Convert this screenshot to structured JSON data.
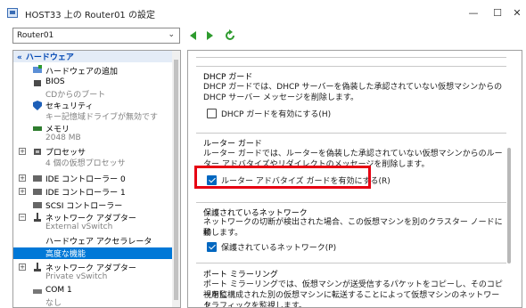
{
  "window": {
    "title": "HOST33 上の Router01 の設定",
    "minimize_glyph": "—",
    "maximize_glyph": "☐",
    "close_glyph": "✕"
  },
  "toolbar": {
    "vm_selected": "Router01"
  },
  "tree": {
    "section_label": "ハードウェア",
    "items": [
      {
        "label": "ハードウェアの追加",
        "sub": ""
      },
      {
        "label": "BIOS",
        "sub": "CDからのブート"
      },
      {
        "label": "セキュリティ",
        "sub": "キー記憶域ドライブが無効です"
      },
      {
        "label": "メモリ",
        "sub": "2048 MB"
      },
      {
        "label": "プロセッサ",
        "sub": "4 個の仮想プロセッサ"
      },
      {
        "label": "IDE コントローラー 0",
        "sub": ""
      },
      {
        "label": "IDE コントローラー 1",
        "sub": ""
      },
      {
        "label": "SCSI コントローラー",
        "sub": ""
      },
      {
        "label": "ネットワーク アダプター",
        "sub": "External vSwitch"
      },
      {
        "label": "ハードウェア アクセラレータ",
        "sub": ""
      },
      {
        "label": "高度な機能",
        "sub": ""
      },
      {
        "label": "ネットワーク アダプター",
        "sub": "Private vSwitch"
      },
      {
        "label": "COM 1",
        "sub": "なし"
      }
    ]
  },
  "panel": {
    "dhcp_guard": {
      "title": "DHCP ガード",
      "desc_line1": "DHCP ガードでは、DHCP サーバーを偽装した承認されていない仮想マシンからの",
      "desc_line2": "DHCP サーバー メッセージを削除します。",
      "checkbox_label": "DHCP ガードを有効にする(H)",
      "checked": false
    },
    "router_guard": {
      "title": "ルーター ガード",
      "desc_line1": "ルーター ガードでは、ルーターを偽装した承認されていない仮想マシンからのルー",
      "desc_line2": "ター アドバタイズやリダイレクトのメッセージを削除します。",
      "checkbox_label": "ルーター アドバタイズ ガードを有効にする(R)",
      "checked": true
    },
    "protected_network": {
      "title": "保護されているネットワーク",
      "desc_line1": "ネットワークの切断が検出された場合、この仮想マシンを別のクラスター ノードに移",
      "desc_line2": "動します。",
      "checkbox_label": "保護されているネットワーク(P)",
      "checked": true
    },
    "port_mirroring": {
      "title": "ポート ミラーリング",
      "desc_line1": "ポート ミラーリングでは、仮想マシンが送受信するパケットをコピーし、そのコピーを監",
      "desc_line2": "視用に構成された別の仮想マシンに転送することによって仮想マシンのネットワーク",
      "desc_line3": "トラフィックを監視します。"
    }
  },
  "colors": {
    "accent": "#0078d7",
    "highlight": "#e60012",
    "nav_green": "#2e9b2e"
  }
}
